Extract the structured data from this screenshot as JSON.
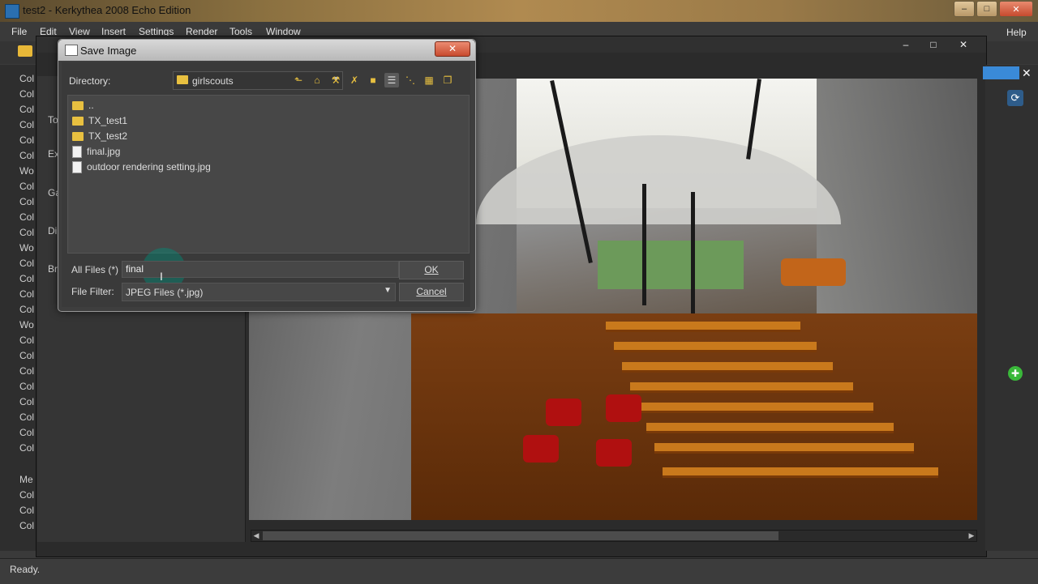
{
  "app": {
    "title": "test2 - Kerkythea 2008 Echo Edition",
    "window_controls": [
      "–",
      "□",
      "✕"
    ]
  },
  "menu": [
    "File",
    "Edit",
    "View",
    "Insert",
    "Settings",
    "Render",
    "Tools",
    "Window"
  ],
  "help_label": "Help",
  "left_list": [
    "Col",
    "Col",
    "Col",
    "Col",
    "Col",
    "Col",
    "Wo",
    "Col",
    "Col",
    "Col",
    "Col",
    "Wo",
    "Col",
    "Col",
    "Col",
    "Col",
    "Wo",
    "Col",
    "Col",
    "Col",
    "Col",
    "Col",
    "Col",
    "Col",
    "Col",
    "Me",
    "Col",
    "Col",
    "Col"
  ],
  "props_labels": [
    "To",
    "Ex",
    "Ga",
    "Di",
    "Br"
  ],
  "status": {
    "text": "Ready."
  },
  "dialog": {
    "title": "Save Image",
    "close_label": "✕",
    "directory_label": "Directory:",
    "directory_value": "girlscouts",
    "toolbar_icons": [
      "up-folder-icon",
      "home-icon",
      "wrench-icon",
      "delete-icon",
      "new-folder-icon",
      "list-view-icon",
      "detail-view-icon",
      "grid-view-icon",
      "clipboard-icon"
    ],
    "files": [
      {
        "name": "..",
        "type": "folder"
      },
      {
        "name": "TX_test1",
        "type": "folder"
      },
      {
        "name": "TX_test2",
        "type": "folder"
      },
      {
        "name": "final.jpg",
        "type": "file"
      },
      {
        "name": "outdoor rendering setting.jpg",
        "type": "file"
      }
    ],
    "name_label": "All Files (*)",
    "name_value": "final",
    "filter_label": "File Filter:",
    "filter_value": "JPEG Files (*.jpg)",
    "ok_label": "OK",
    "cancel_label": "Cancel"
  },
  "colors": {
    "accent_blue": "#3a8ad8",
    "close_red": "#c84a2e",
    "folder_yellow": "#e8c040"
  }
}
